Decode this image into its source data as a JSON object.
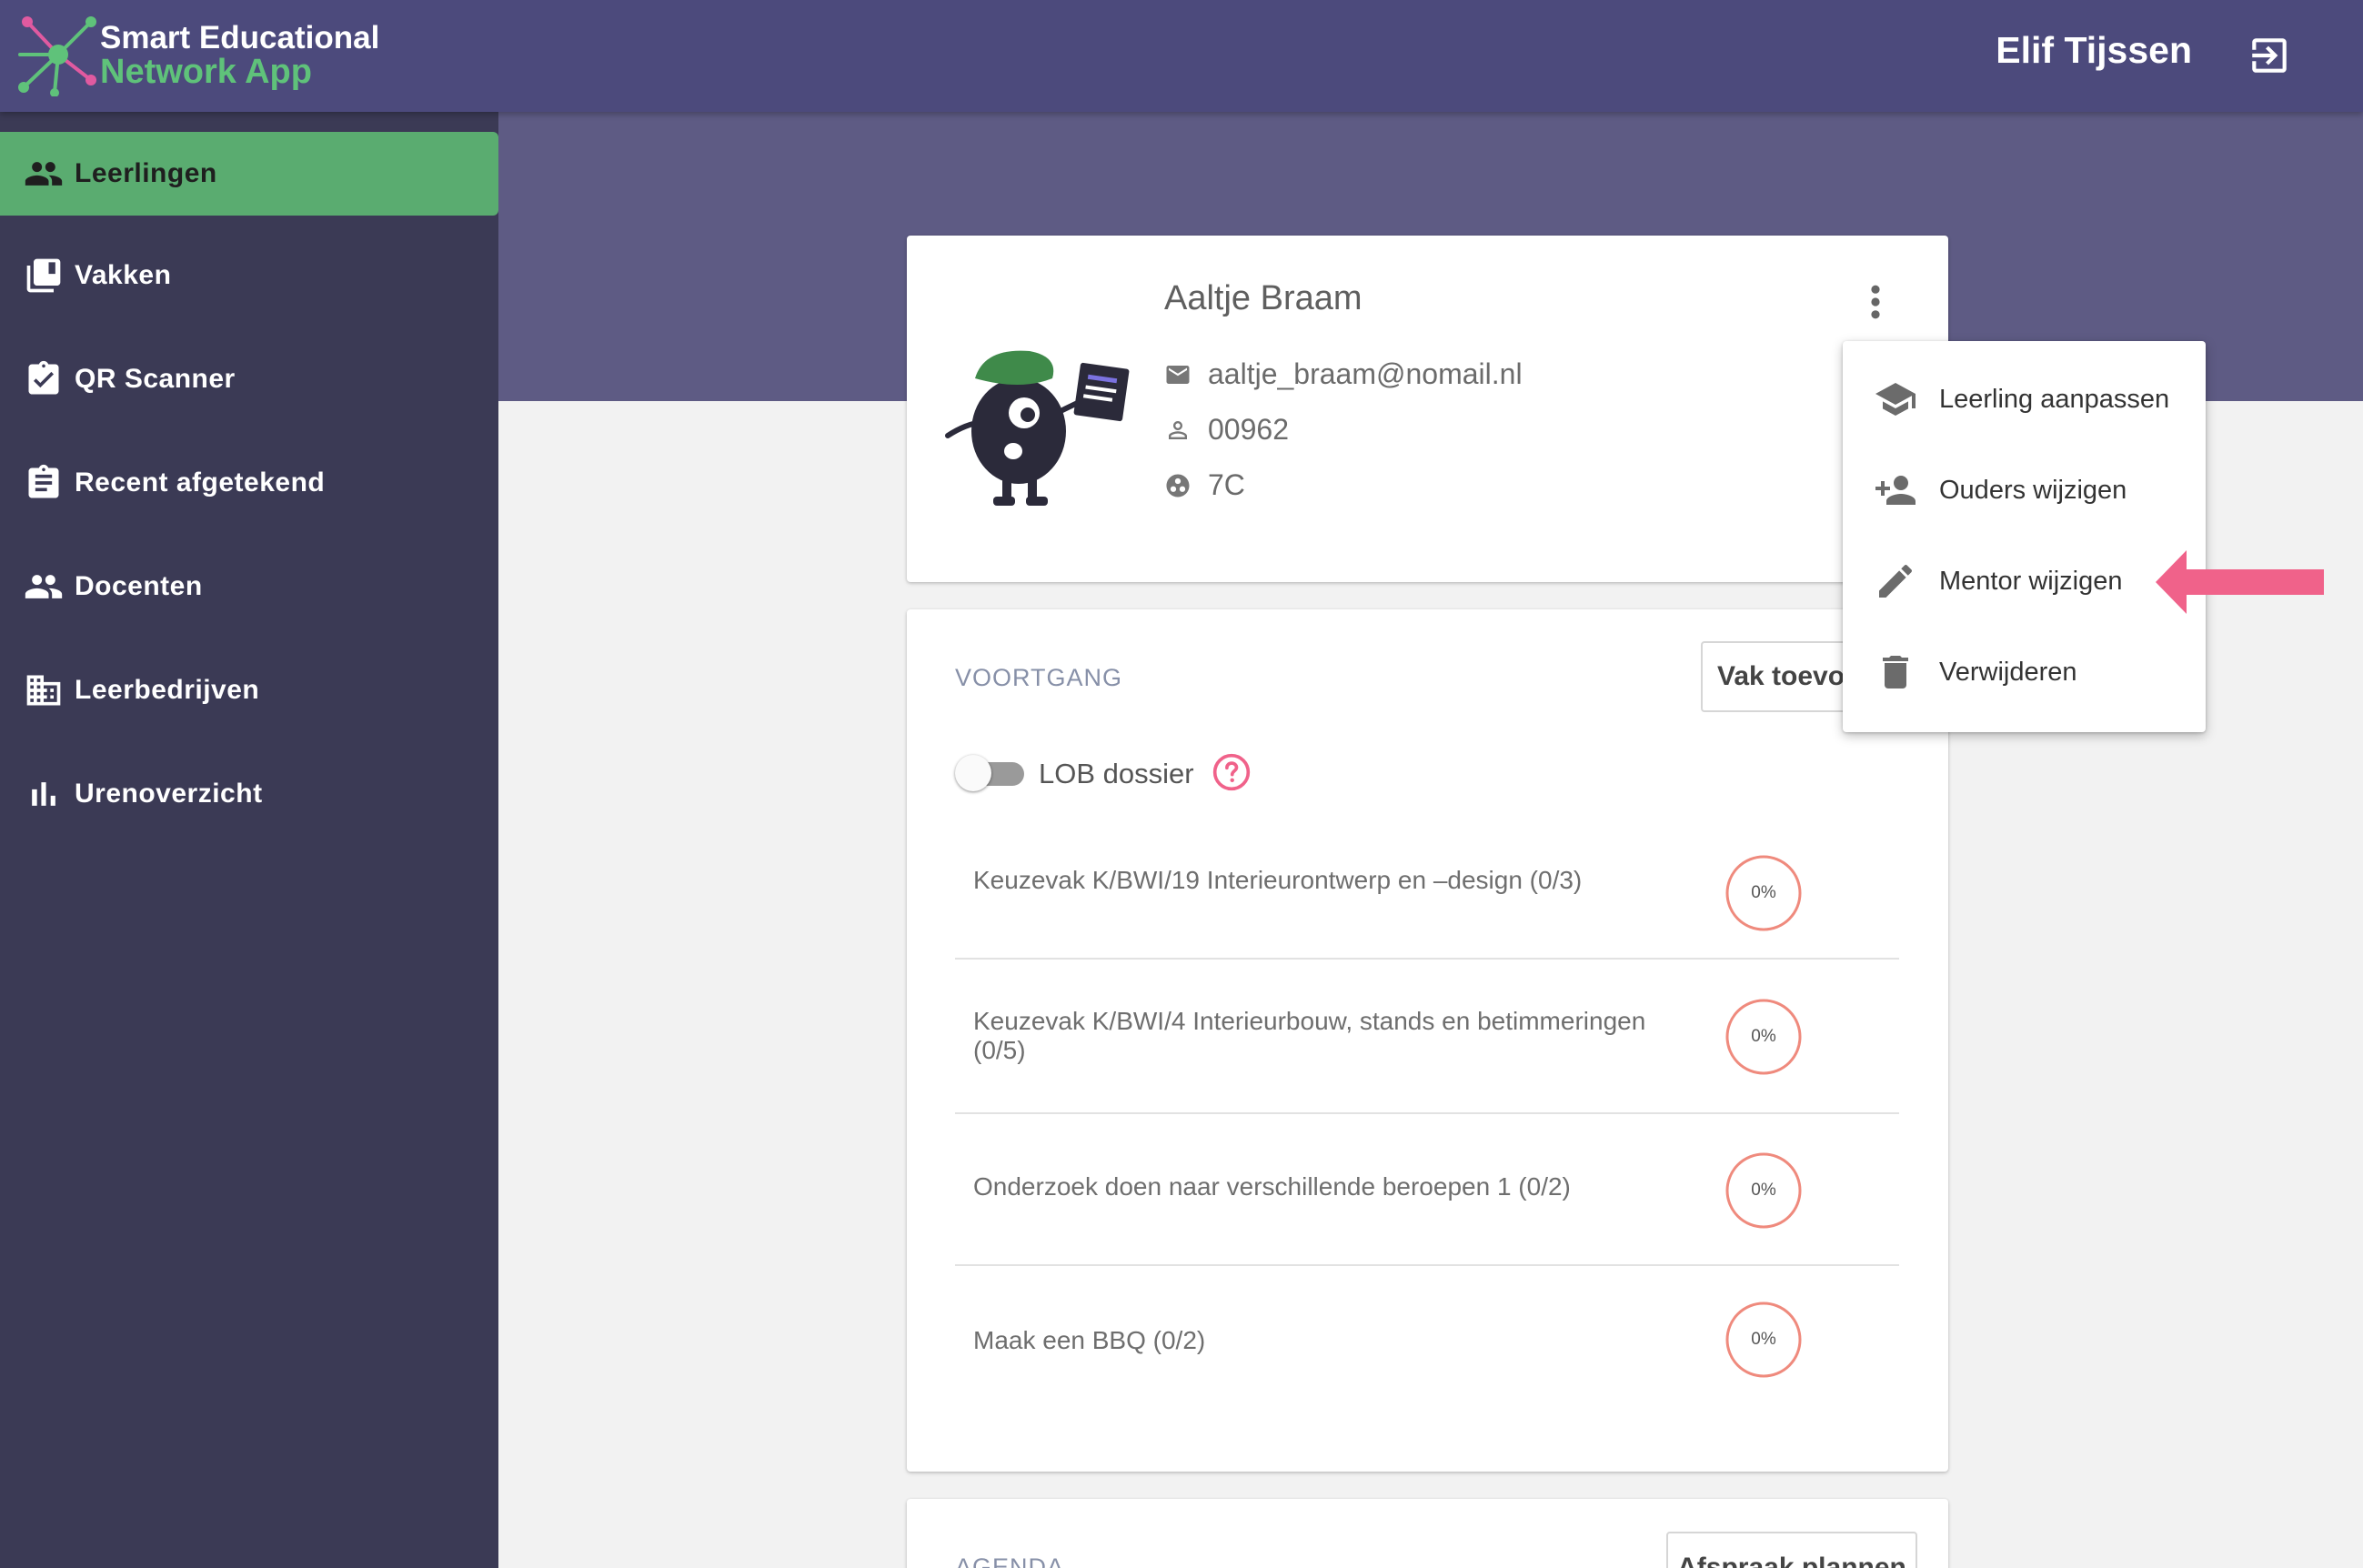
{
  "app": {
    "logo_line1": "Smart Educational",
    "logo_line2": "Network App",
    "user_name": "Elif Tijssen",
    "brand_color": "#4c4a7c",
    "accent_color": "#5aac70"
  },
  "sidebar": {
    "items": [
      {
        "label": "Leerlingen",
        "icon": "people-icon",
        "active": true
      },
      {
        "label": "Vakken",
        "icon": "library-books-icon"
      },
      {
        "label": "QR Scanner",
        "icon": "clipboard-check-icon"
      },
      {
        "label": "Recent afgetekend",
        "icon": "clipboard-list-icon"
      },
      {
        "label": "Docenten",
        "icon": "people-icon"
      },
      {
        "label": "Leerbedrijven",
        "icon": "building-icon"
      },
      {
        "label": "Urenoverzicht",
        "icon": "bar-chart-icon"
      }
    ]
  },
  "student": {
    "name": "Aaltje Braam",
    "email": "aaltje_braam@nomail.nl",
    "number": "00962",
    "class": "7C"
  },
  "progress": {
    "title": "VOORTGANG",
    "add_button": "Vak toevo",
    "lob_label": "LOB dossier",
    "lob_enabled": false,
    "subjects": [
      {
        "name": "Keuzevak K/BWI/19 Interieurontwerp en –design (0/3)",
        "percent": "0%",
        "value": 0
      },
      {
        "name": "Keuzevak K/BWI/4 Interieurbouw, stands en betimmeringen (0/5)",
        "percent": "0%",
        "value": 0
      },
      {
        "name": "Onderzoek doen naar verschillende beroepen 1 (0/2)",
        "percent": "0%",
        "value": 0
      },
      {
        "name": "Maak een BBQ (0/2)",
        "percent": "0%",
        "value": 0
      }
    ]
  },
  "agenda": {
    "title": "AGENDA",
    "plan_button": "Afspraak plannen"
  },
  "menu": {
    "items": [
      {
        "label": "Leerling aanpassen",
        "icon": "school-icon"
      },
      {
        "label": "Ouders wijzigen",
        "icon": "person-add-icon"
      },
      {
        "label": "Mentor wijzigen",
        "icon": "pencil-icon",
        "highlighted": true
      },
      {
        "label": "Verwijderen",
        "icon": "trash-icon"
      }
    ]
  },
  "annotation_color": "#f0628a"
}
